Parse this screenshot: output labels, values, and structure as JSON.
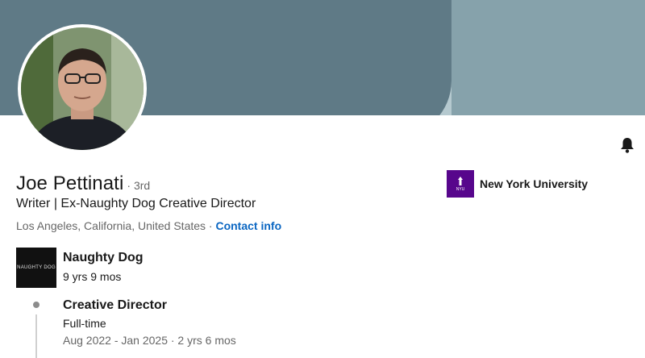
{
  "profile": {
    "name": "Joe Pettinati",
    "degree": "· 3rd",
    "headline": "Writer | Ex-Naughty Dog Creative Director",
    "location": "Los Angeles, California, United States · ",
    "contact_label": "Contact info"
  },
  "education": {
    "school": "New York University",
    "logo_text": "NYU"
  },
  "experience": {
    "company": "Naughty Dog",
    "logo_text": "NAUGHTY DOG",
    "total_duration": "9 yrs 9 mos",
    "positions": [
      {
        "title": "Creative Director",
        "employment_type": "Full-time",
        "dates": "Aug 2022 - Jan 2025 · 2 yrs 6 mos"
      }
    ]
  },
  "colors": {
    "link": "#0a66c2",
    "nyu_purple": "#57068c",
    "banner": "#5f7a86"
  },
  "icons": {
    "notify": "bell-icon"
  }
}
